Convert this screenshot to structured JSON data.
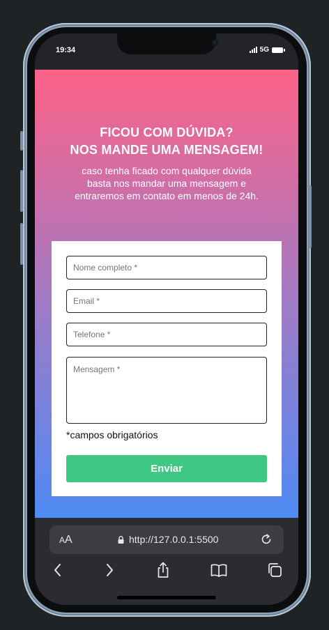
{
  "status_bar": {
    "time": "19:34",
    "network": "5G"
  },
  "page": {
    "title_line1": "FICOU COM DÚVIDA?",
    "title_line2": "NOS MANDE UMA MENSAGEM!",
    "subtitle_line1": "caso tenha ficado com qualquer dúvida",
    "subtitle_line2": "basta nos mandar uma mensagem e",
    "subtitle_line3": "entraremos em contato em menos de 24h.",
    "gradient_top": "#fd6288",
    "gradient_bottom": "#4f8af5"
  },
  "form": {
    "name_placeholder": "Nome completo *",
    "email_placeholder": "Email *",
    "phone_placeholder": "Telefone *",
    "message_placeholder": "Mensagem *",
    "required_note": "*campos obrigatórios",
    "submit_label": "Enviar",
    "submit_color": "#3ec884"
  },
  "browser": {
    "text_size_small": "A",
    "text_size_large": "A",
    "url": "http://127.0.0.1:5500",
    "icons": [
      "lock-icon",
      "reload-icon",
      "back-icon",
      "forward-icon",
      "share-icon",
      "bookmarks-icon",
      "tabs-icon"
    ]
  }
}
